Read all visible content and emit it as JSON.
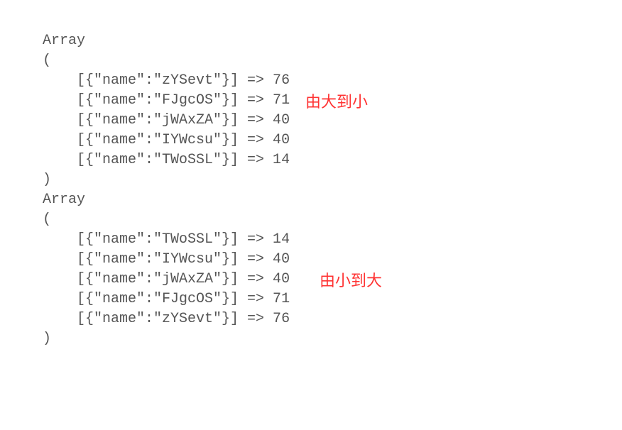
{
  "code": {
    "block1_header": "Array",
    "open_paren": "(",
    "close_paren": ")",
    "indent": "    ",
    "arrays": [
      {
        "lines": [
          "[{\"name\":\"zYSevt\"}] => 76",
          "[{\"name\":\"FJgcOS\"}] => 71",
          "[{\"name\":\"jWAxZA\"}] => 40",
          "[{\"name\":\"IYWcsu\"}] => 40",
          "[{\"name\":\"TWoSSL\"}] => 14"
        ]
      },
      {
        "lines": [
          "[{\"name\":\"TWoSSL\"}] => 14",
          "[{\"name\":\"IYWcsu\"}] => 40",
          "[{\"name\":\"jWAxZA\"}] => 40",
          "[{\"name\":\"FJgcOS\"}] => 71",
          "[{\"name\":\"zYSevt\"}] => 76"
        ]
      }
    ]
  },
  "annotations": {
    "desc1": "由大到小",
    "desc2": "由小到大"
  }
}
